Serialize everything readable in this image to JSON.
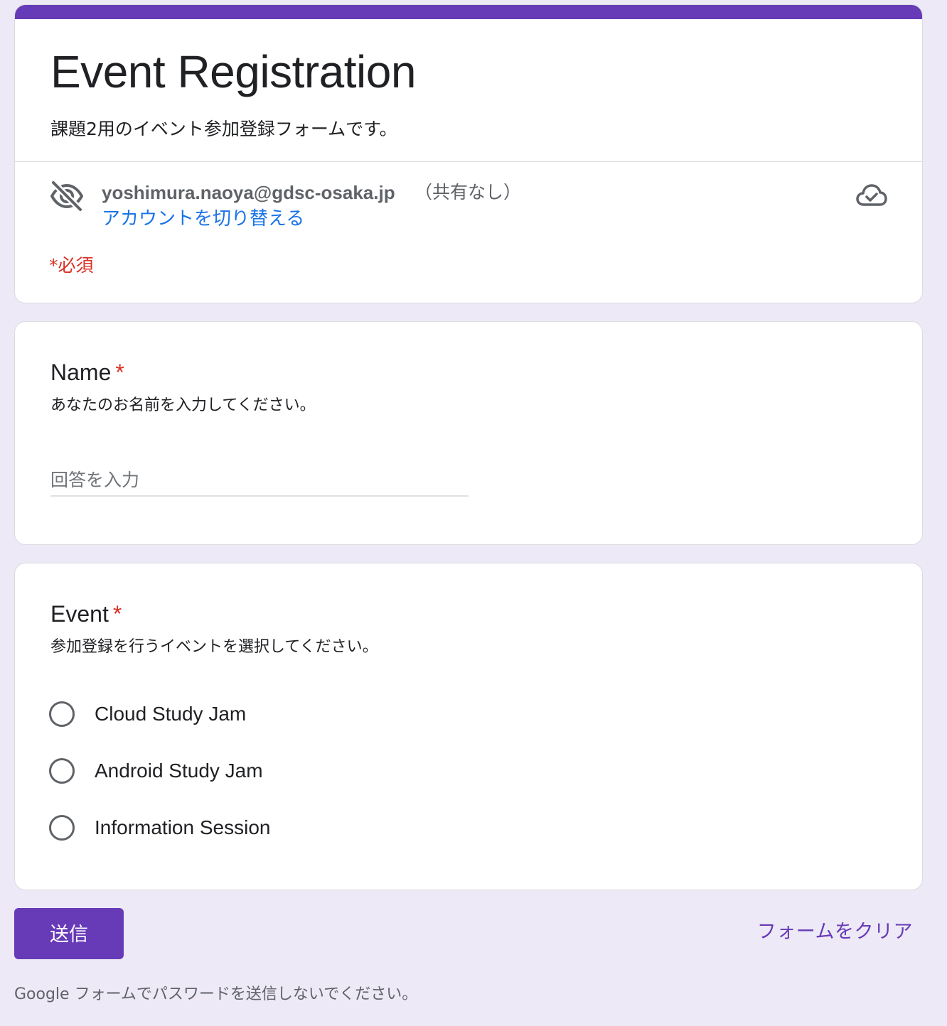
{
  "header": {
    "title": "Event Registration",
    "description": "課題2用のイベント参加登録フォームです。",
    "account_email": "yoshimura.naoya@gdsc-osaka.jp",
    "share_status": "（共有なし）",
    "switch_account_label": "アカウントを切り替える",
    "required_note": "*必須",
    "accent_color": "#673ab7",
    "icons": [
      "hidden-eye-icon",
      "cloud-done-icon"
    ]
  },
  "questions": {
    "name": {
      "title": "Name",
      "required_mark": "*",
      "help": "あなたのお名前を入力してください。",
      "placeholder": "回答を入力",
      "value": ""
    },
    "event": {
      "title": "Event",
      "required_mark": "*",
      "help": "参加登録を行うイベントを選択してください。",
      "options": [
        "Cloud Study Jam",
        "Android Study Jam",
        "Information Session"
      ]
    }
  },
  "footer": {
    "submit_label": "送信",
    "clear_label": "フォームをクリア",
    "password_warning": "Google フォームでパスワードを送信しないでください。"
  }
}
